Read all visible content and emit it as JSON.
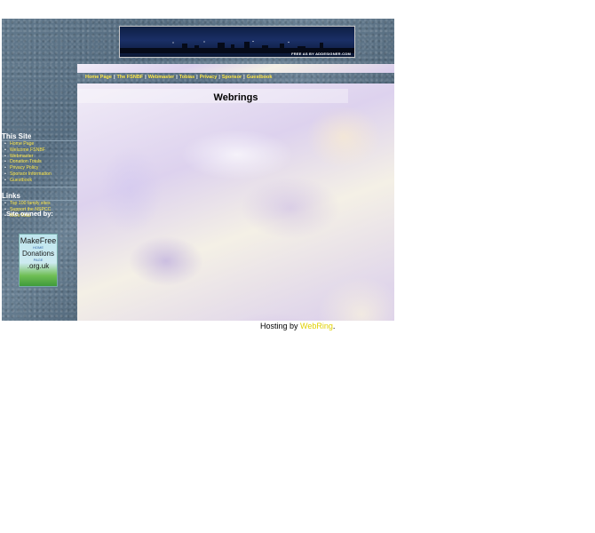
{
  "banner": {
    "credit": "FREE AS BY ADDESIGNER.COM"
  },
  "nav": {
    "links": [
      "Home Page",
      "The FSNBF",
      "Webmaster",
      "Tobias",
      "Privacy",
      "Sponsor",
      "Guestbook"
    ]
  },
  "sidebar": {
    "this_site": {
      "heading": "This Site",
      "items": [
        "Home Page",
        "Welcome FSNBF",
        "Webmaster",
        "Donation Totals",
        "Privacy Policy",
        "Sponsor Information",
        "Guestbook"
      ]
    },
    "links": {
      "heading": "Links",
      "items": [
        "Top 100 family sites",
        "Support the NSPCC",
        "More links"
      ]
    },
    "owned_by": "Site owned by:",
    "logo": {
      "line1": "MakeFree",
      "line2": "HOME",
      "line3": "Donations",
      "line4": "PAGE",
      "line5": ".org.uk"
    }
  },
  "main": {
    "title": "Webrings"
  },
  "footer": {
    "prefix": "Hosting by ",
    "link": "WebRing",
    "suffix": "."
  },
  "colors": {
    "link_yellow": "#ffe84a",
    "slate": "#5d7588",
    "marble": "#e9e2f2"
  }
}
